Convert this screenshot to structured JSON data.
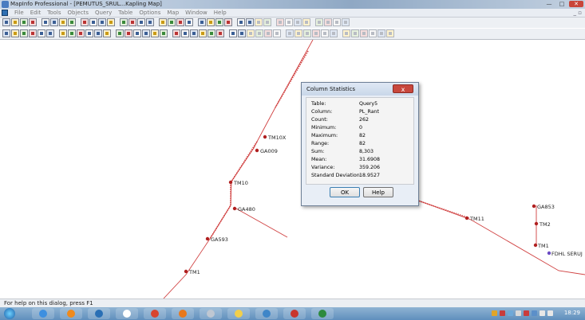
{
  "window": {
    "title": "MapInfo Professional - [PEMUTUS_SRUL...Kapling Map]"
  },
  "menu": [
    "File",
    "Edit",
    "Tools",
    "Objects",
    "Query",
    "Table",
    "Options",
    "Map",
    "Window",
    "Help"
  ],
  "map": {
    "line_color": "#d04040",
    "labels": {
      "tm10x": "TM10X",
      "ga009": "GA009",
      "tm10": "TM10",
      "ga480": "GA480",
      "ga593": "GA593",
      "tm1_left": "TM1",
      "ga853": "GA853",
      "tm2": "TM2",
      "tm11": "TM11",
      "tm1_right": "TM1",
      "fdh": "FDHL SERUJ"
    }
  },
  "dialog": {
    "title": "Column Statistics",
    "close_label": "x",
    "rows": [
      {
        "label": "Table:",
        "value": "Query5"
      },
      {
        "label": "Column:",
        "value": "PL_Rant"
      },
      {
        "label": "Count:",
        "value": "262"
      },
      {
        "label": "Minimum:",
        "value": "0"
      },
      {
        "label": "Maximum:",
        "value": "82"
      },
      {
        "label": "Range:",
        "value": "82"
      },
      {
        "label": "Sum:",
        "value": "8,303"
      },
      {
        "label": "Mean:",
        "value": "31.6908"
      },
      {
        "label": "Variance:",
        "value": "359.206"
      },
      {
        "label": "Standard Deviation:",
        "value": "18.9527"
      }
    ],
    "ok_label": "OK",
    "help_label": "Help"
  },
  "status": {
    "text": "For help on this dialog, press F1"
  },
  "taskbar": {
    "clock": "18:29"
  }
}
